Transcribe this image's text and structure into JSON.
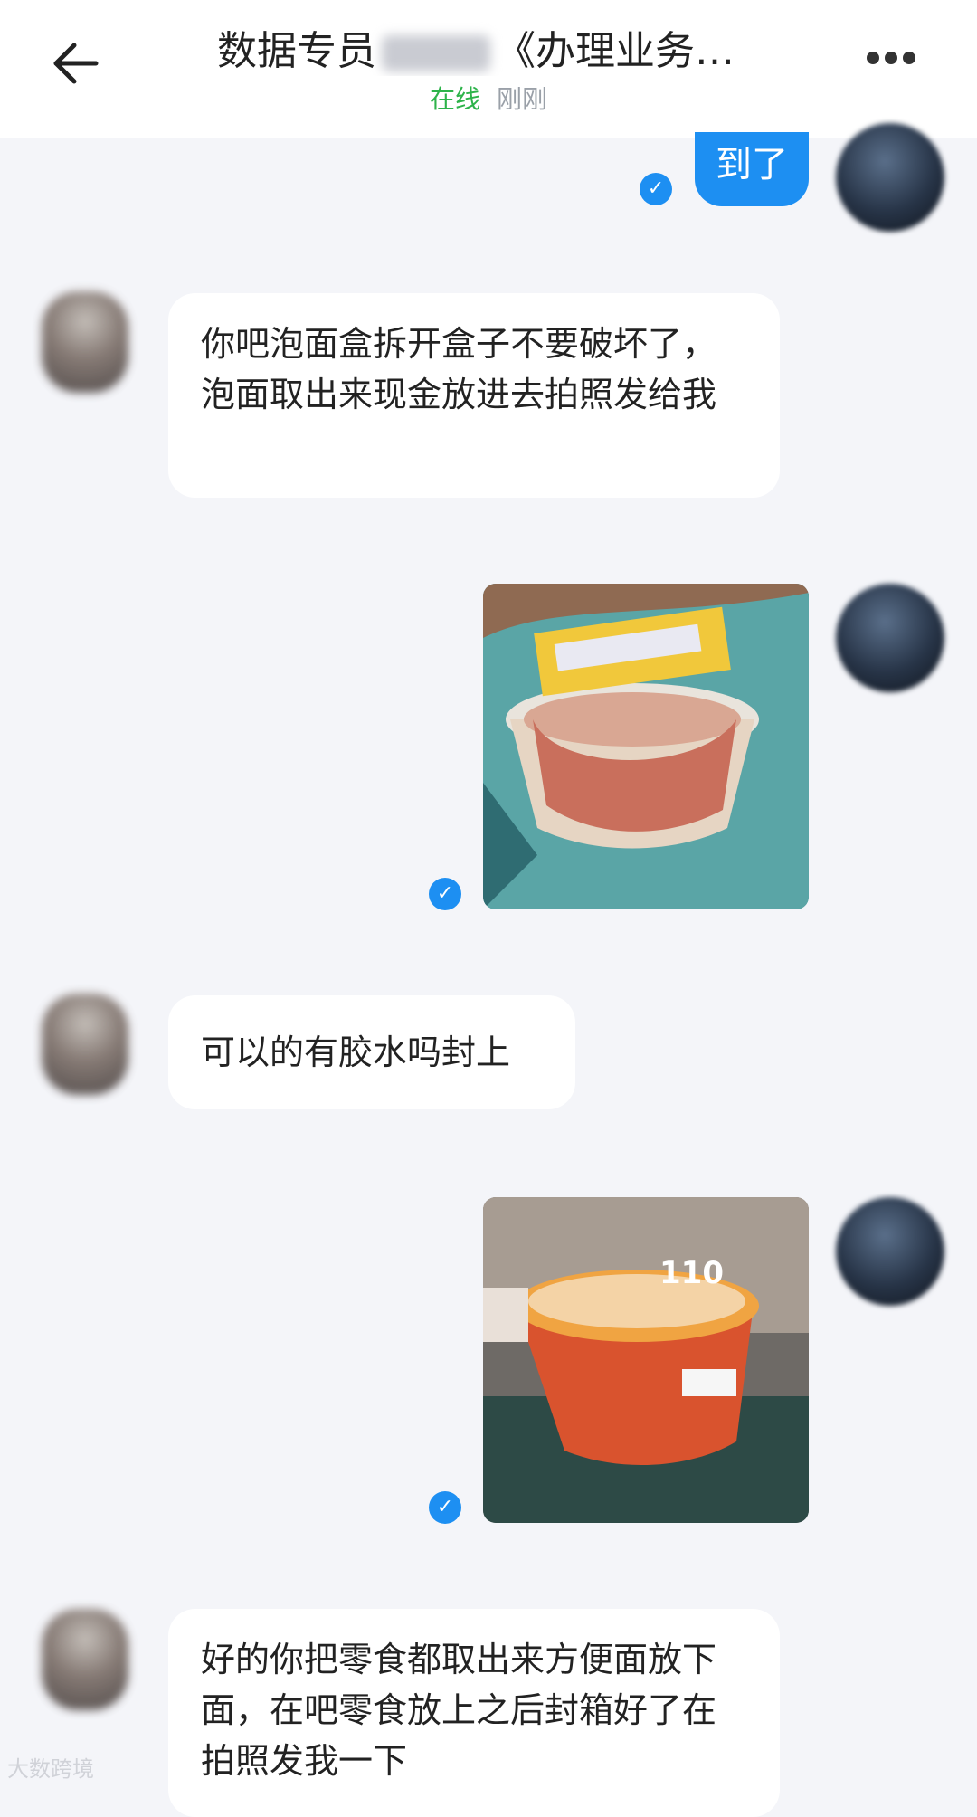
{
  "header": {
    "title_prefix": "数据专员",
    "title_suffix": "《办理业务…",
    "status_online": "在线",
    "status_time": "刚刚"
  },
  "messages": [
    {
      "from": "self",
      "type": "text",
      "text": "到了"
    },
    {
      "from": "other",
      "type": "text",
      "text": "你吧泡面盒拆开盒子不要破坏了，泡面取出来现金放进去拍照发给我"
    },
    {
      "from": "self",
      "type": "image"
    },
    {
      "from": "other",
      "type": "text",
      "text": "可以的有胶水吗封上"
    },
    {
      "from": "self",
      "type": "image",
      "overlay_text": "110"
    },
    {
      "from": "other",
      "type": "text",
      "text": "好的你把零食都取出来方便面放下面，在吧零食放上之后封箱好了在拍照发我一下"
    }
  ],
  "icons": {
    "back": "arrow-left-icon",
    "more": "more-icon",
    "check": "check-icon"
  },
  "watermark": "大数跨境",
  "colors": {
    "accent": "#1d8ff2",
    "online": "#2db34a",
    "background": "#f4f5f9"
  }
}
